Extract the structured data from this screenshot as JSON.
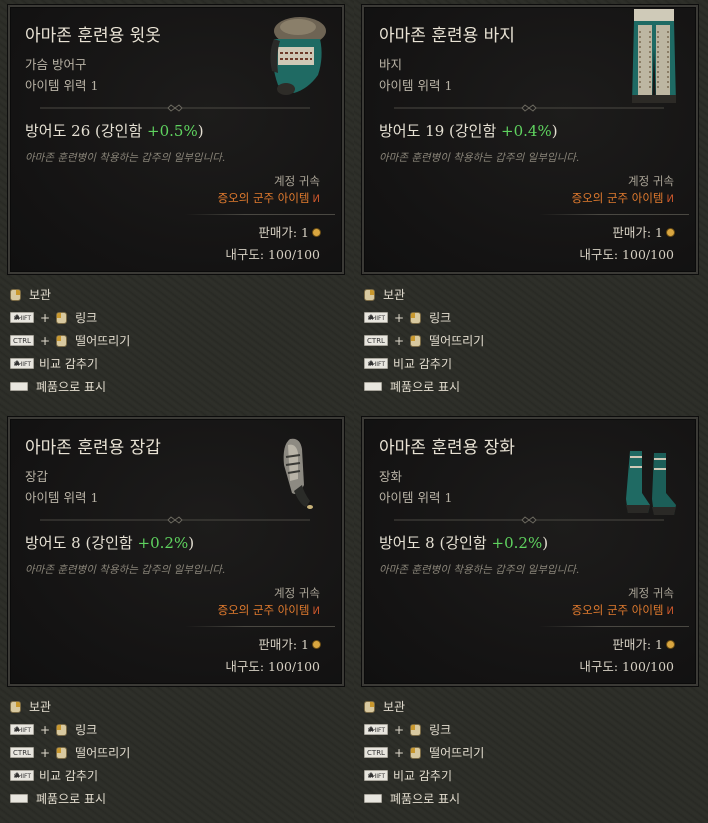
{
  "panels": [
    {
      "title": "아마존 훈련용 윗옷",
      "type": "가슴 방어구",
      "power": "아이템 위력 1",
      "stat_text": "방어도 26 (강인함 ",
      "stat_bonus": "+0.5%",
      "stat_close": ")",
      "flavor": "아마존 훈련병이 착용하는 갑주의 일부입니다.",
      "account": "계정 귀속",
      "set": "증오의 군주 아이템",
      "price": "판매가: 1",
      "durability": "내구도: 100/100",
      "icon": "amazon-chest-armor-icon"
    },
    {
      "title": "아마존 훈련용 바지",
      "type": "바지",
      "power": "아이템 위력 1",
      "stat_text": "방어도 19 (강인함 ",
      "stat_bonus": "+0.4%",
      "stat_close": ")",
      "flavor": "아마존 훈련병이 착용하는 갑주의 일부입니다.",
      "account": "계정 귀속",
      "set": "증오의 군주 아이템",
      "price": "판매가: 1",
      "durability": "내구도: 100/100",
      "icon": "amazon-pants-icon"
    },
    {
      "title": "아마존 훈련용 장갑",
      "type": "장갑",
      "power": "아이템 위력 1",
      "stat_text": "방어도 8 (강인함 ",
      "stat_bonus": "+0.2%",
      "stat_close": ")",
      "flavor": "아마존 훈련병이 착용하는 갑주의 일부입니다.",
      "account": "계정 귀속",
      "set": "증오의 군주 아이템",
      "price": "판매가: 1",
      "durability": "내구도: 100/100",
      "icon": "amazon-gloves-icon"
    },
    {
      "title": "아마존 훈련용 장화",
      "type": "장화",
      "power": "아이템 위력 1",
      "stat_text": "방어도 8 (강인함 ",
      "stat_bonus": "+0.2%",
      "stat_close": ")",
      "flavor": "아마존 훈련병이 착용하는 갑주의 일부입니다.",
      "account": "계정 귀속",
      "set": "증오의 군주 아이템",
      "price": "판매가: 1",
      "durability": "내구도: 100/100",
      "icon": "amazon-boots-icon"
    }
  ],
  "actions": {
    "stash": "보관",
    "link": "링크",
    "drop": "떨어뜨리기",
    "hide_compare": "비교 감추기",
    "mark_junk": "폐품으로 표시"
  },
  "keys": {
    "shift": "SHIFT",
    "ctrl": "CTRL"
  },
  "colors": {
    "bonus": "#5fd35f",
    "set": "#e07a2e",
    "tooltip_bg": "#141313"
  }
}
